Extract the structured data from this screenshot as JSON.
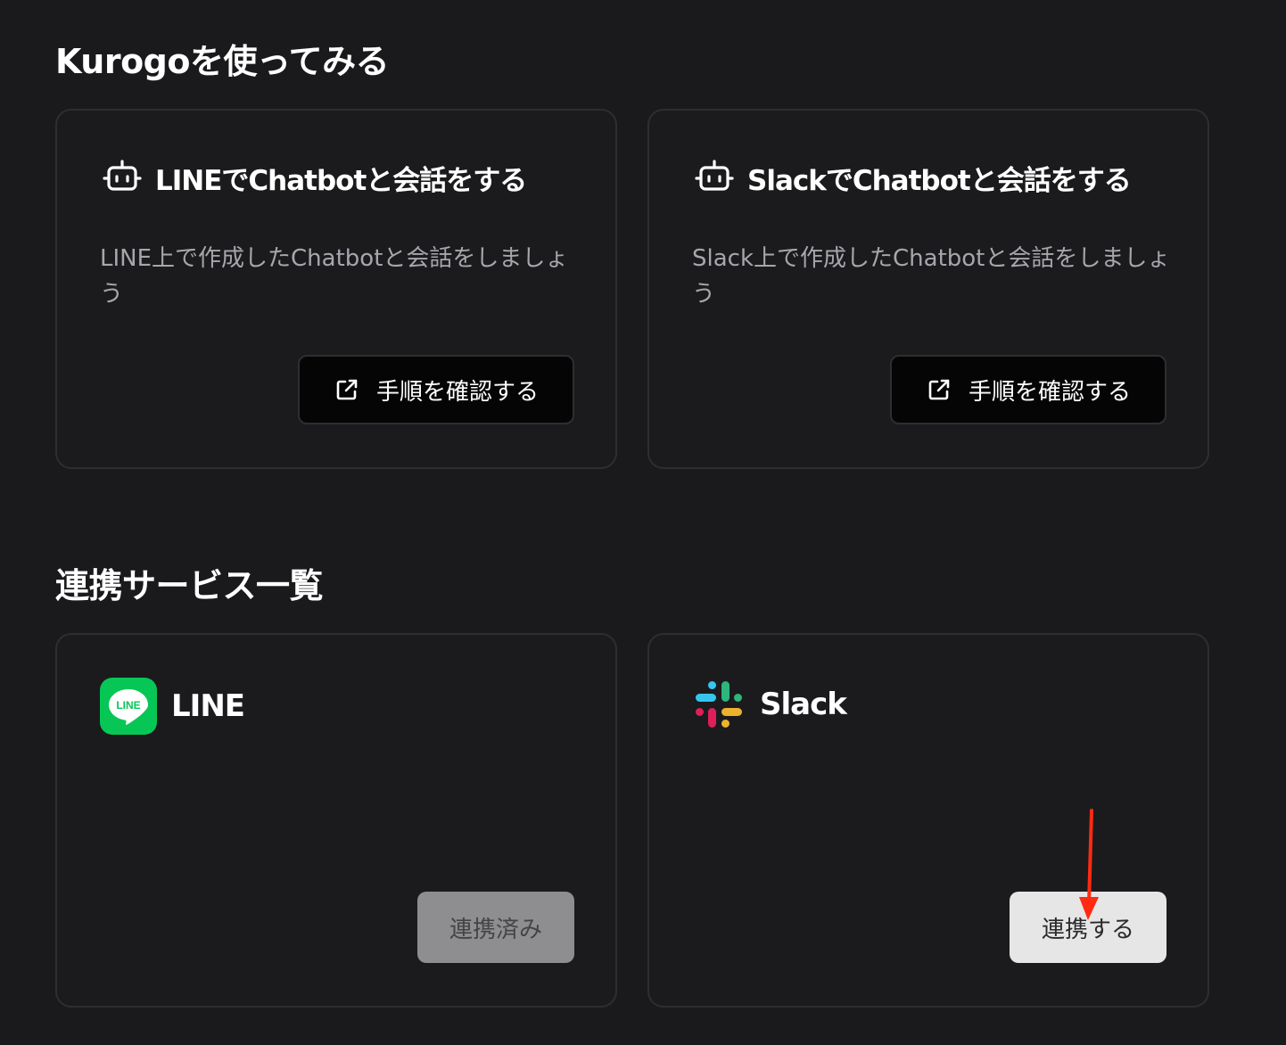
{
  "sections": {
    "try_title": "Kurogoを使ってみる",
    "services_title": "連携サービス一覧"
  },
  "guides": [
    {
      "icon": "robot-icon",
      "title": "LINEでChatbotと会話をする",
      "description": "LINE上で作成したChatbotと会話をしましょう",
      "button_icon": "external-link-icon",
      "button_label": "手順を確認する"
    },
    {
      "icon": "robot-icon",
      "title": "SlackでChatbotと会話をする",
      "description": "Slack上で作成したChatbotと会話をしましょう",
      "button_icon": "external-link-icon",
      "button_label": "手順を確認する"
    }
  ],
  "services": [
    {
      "logo": "line-logo",
      "logo_text": "LINE",
      "name": "LINE",
      "button_label": "連携済み",
      "state": "connected"
    },
    {
      "logo": "slack-logo",
      "name": "Slack",
      "button_label": "連携する",
      "state": "not-connected"
    }
  ],
  "annotation": {
    "type": "red-arrow",
    "points_to": "slack-connect-button",
    "color": "#ff2a12"
  },
  "colors": {
    "background": "#1a1a1c",
    "card_border": "#2e2e32",
    "line_green": "#06c755",
    "connected_button": "#8e8e90",
    "connect_button": "#e6e6e6"
  }
}
